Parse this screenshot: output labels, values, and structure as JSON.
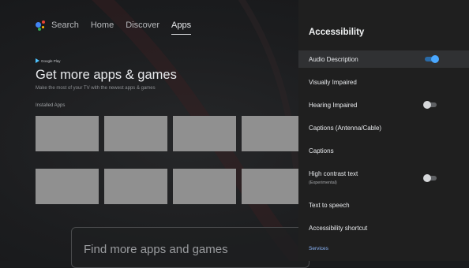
{
  "nav": {
    "search": "Search",
    "home": "Home",
    "discover": "Discover",
    "apps": "Apps"
  },
  "store": {
    "brand": "Google Play",
    "headline": "Get more apps & games",
    "subline": "Make the most of your TV with the newest apps & games",
    "section": "Installed Apps",
    "find": "Find more apps and games"
  },
  "panel": {
    "title": "Accessibility",
    "items": [
      {
        "label": "Audio Description",
        "toggle": "on"
      },
      {
        "label": "Visually Impaired"
      },
      {
        "label": "Hearing Impaired",
        "toggle": "off"
      },
      {
        "label": "Captions (Antenna/Cable)"
      },
      {
        "label": "Captions"
      },
      {
        "label": "High contrast text",
        "sub": "(Experimental)",
        "toggle": "off"
      },
      {
        "label": "Text to speech"
      },
      {
        "label": "Accessibility shortcut"
      }
    ],
    "services": "Services"
  },
  "colors": {
    "accent": "#8ab4f8",
    "toggle_on": "#4aa8ff",
    "panel_bg": "#1f1f1f"
  }
}
